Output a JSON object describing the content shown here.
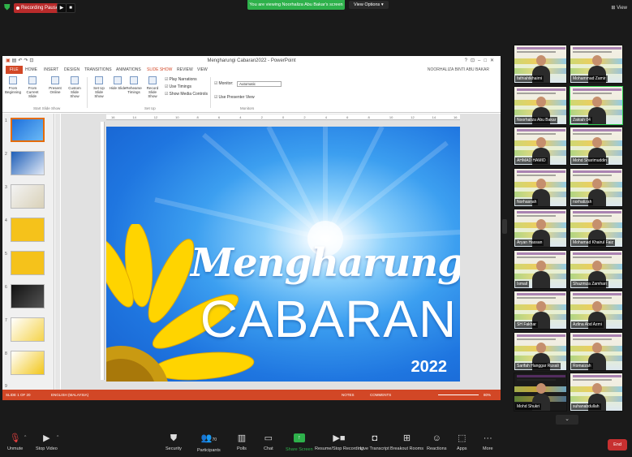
{
  "topbar": {
    "recording_label": "Recording Paused",
    "viewing_banner": "You are viewing Noorhaliza Abu Bakar's screen",
    "view_options_label": "View Options",
    "view_label": "View"
  },
  "ppt": {
    "window_title": "Mengharungi Cabaran2022 - PowerPoint",
    "user_name": "NOORHALIZA BINTI ABU BAKAR",
    "tabs": [
      "FILE",
      "HOME",
      "INSERT",
      "DESIGN",
      "TRANSITIONS",
      "ANIMATIONS",
      "SLIDE SHOW",
      "REVIEW",
      "VIEW"
    ],
    "ribbon": {
      "from_beginning": "From Beginning",
      "from_current": "From Current Slide",
      "present_online": "Present Online",
      "custom_show": "Custom Slide Show",
      "set_up": "Set Up Slide Show",
      "hide_slide": "Hide Slide",
      "rehearse": "Rehearse Timings",
      "record": "Record Slide Show",
      "play_narrations": "Play Narrations",
      "use_timings": "Use Timings",
      "show_media": "Show Media Controls",
      "monitor_label": "Monitor:",
      "monitor_value": "Automatic",
      "use_presenter": "Use Presenter View",
      "group_start": "Start Slide Show",
      "group_setup": "Set Up",
      "group_monitors": "Monitors"
    },
    "slide_numbers": [
      "1",
      "2",
      "3",
      "4",
      "5",
      "6",
      "7",
      "8",
      "9"
    ],
    "ruler_ticks": [
      "16",
      "15",
      "14",
      "13",
      "12",
      "11",
      "10",
      "9",
      "8",
      "7",
      "6",
      "5",
      "4",
      "3",
      "2",
      "1",
      "0",
      "1",
      "2",
      "3",
      "4",
      "5",
      "6",
      "7",
      "8",
      "9",
      "10",
      "11",
      "12",
      "13",
      "14",
      "15",
      "16"
    ],
    "slide": {
      "title_script": "Mengharungi",
      "title_caps": "CABARAN",
      "year": "2022"
    },
    "status": {
      "slide_info": "SLIDE 1 OF 20",
      "lang": "ENGLISH (MALAYSIA)",
      "notes": "NOTES",
      "comments": "COMMENTS",
      "zoom": "80%"
    }
  },
  "participants": [
    {
      "name": "fathiahtkhairni"
    },
    {
      "name": "Mohammad Zamir"
    },
    {
      "name": "Noorhaliza Abu Bakar"
    },
    {
      "name": "Zakiah 04"
    },
    {
      "name": "AHMAD HAMID"
    },
    {
      "name": "Mohd Sharimuddin"
    },
    {
      "name": "Norhasnah"
    },
    {
      "name": "norhatizah"
    },
    {
      "name": "Aryan Hassan"
    },
    {
      "name": "Mohamad Khairul Faiz"
    },
    {
      "name": "Ismail"
    },
    {
      "name": "Shazmiza Zamhari"
    },
    {
      "name": "SH Fakhar"
    },
    {
      "name": "Azlina Abd Azmi"
    },
    {
      "name": "Sarifah Hanggar Rusali"
    },
    {
      "name": "Romaizah"
    },
    {
      "name": "Mohd Shukri"
    },
    {
      "name": "suhanabdullah"
    }
  ],
  "toolbar": {
    "unmute": "Unmute",
    "stop_video": "Stop Video",
    "security": "Security",
    "participants": "Participants",
    "participants_count": "70",
    "polls": "Polls",
    "chat": "Chat",
    "share_screen": "Share Screen",
    "record": "Resume/Stop Recording",
    "live_transcript": "Live Transcript",
    "breakout": "Breakout Rooms",
    "reactions": "Reactions",
    "apps": "Apps",
    "more": "More",
    "end": "End"
  },
  "colors": {
    "ppt_accent": "#d24726",
    "zoom_green": "#2eb14b",
    "end_red": "#c73030"
  }
}
